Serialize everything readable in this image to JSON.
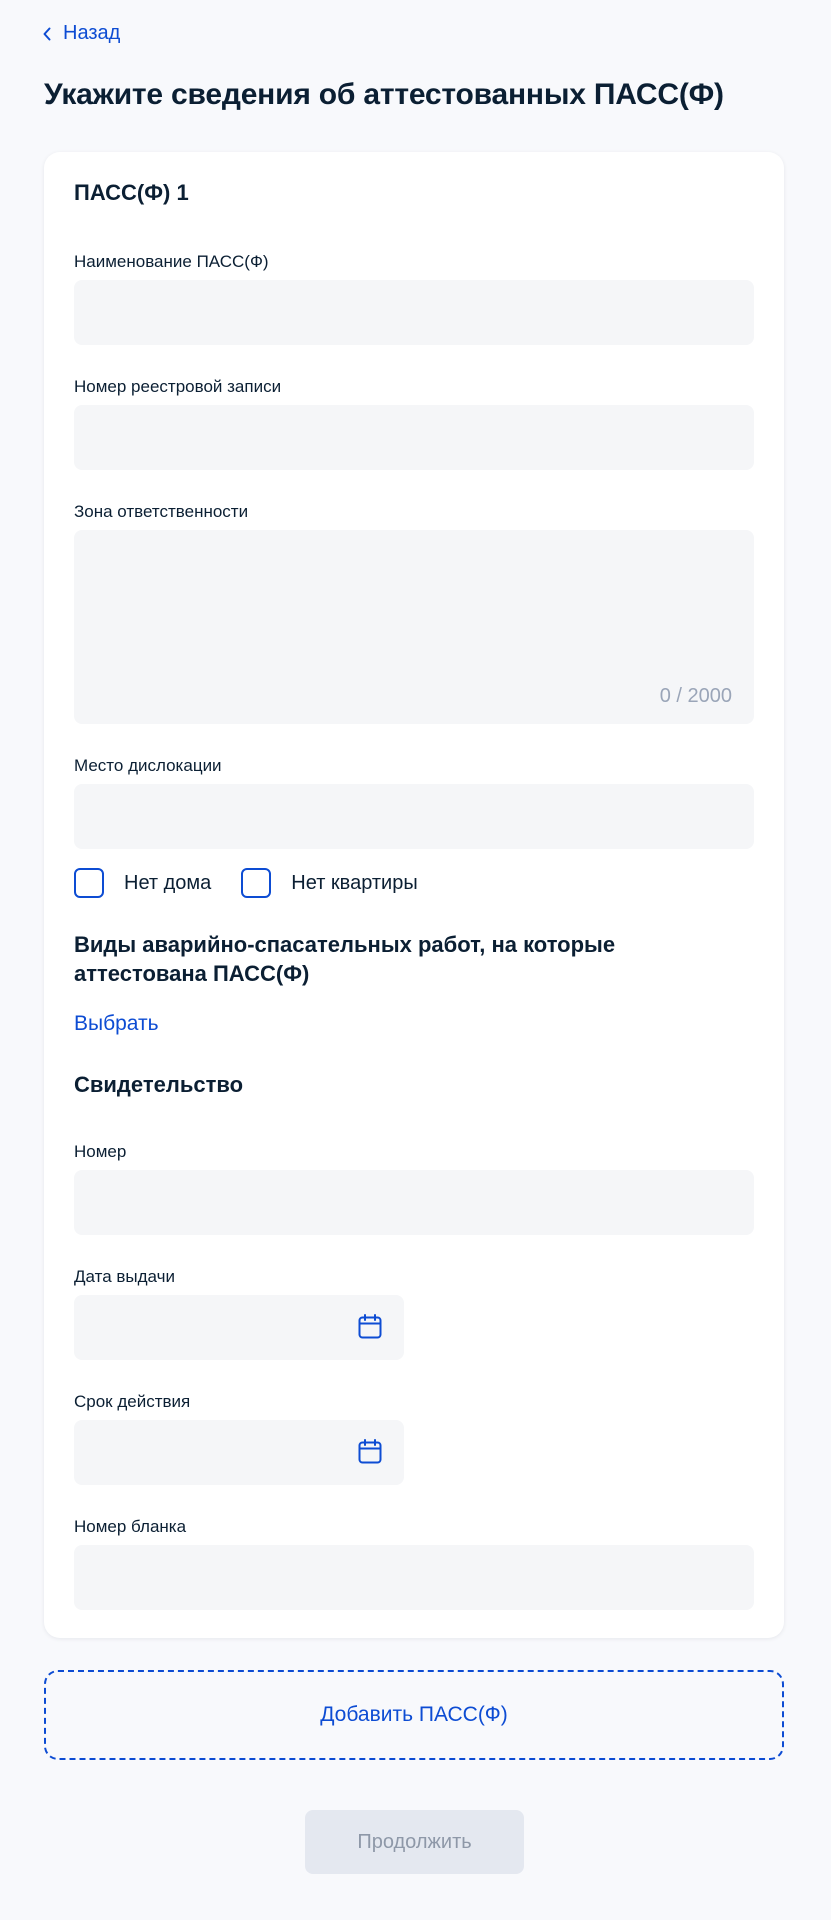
{
  "nav": {
    "back_label": "Назад"
  },
  "page": {
    "title": "Укажите сведения об аттестованных ПАСС(Ф)"
  },
  "card": {
    "title": "ПАСС(Ф) 1",
    "name_label": "Наименование ПАСС(Ф)",
    "registry_label": "Номер реестровой записи",
    "zone_label": "Зона ответственности",
    "zone_counter": "0 / 2000",
    "location_label": "Место дислокации",
    "checkboxes": [
      {
        "label": "Нет дома",
        "checked": false
      },
      {
        "label": "Нет квартиры",
        "checked": false
      }
    ],
    "works_title": "Виды аварийно-спасательных работ, на которые аттестована ПАСС(Ф)",
    "choose_label": "Выбрать",
    "certificate": {
      "title": "Свидетельство",
      "number_label": "Номер",
      "issue_date_label": "Дата выдачи",
      "valid_until_label": "Срок действия",
      "form_number_label": "Номер бланка"
    }
  },
  "actions": {
    "add_label": "Добавить ПАСС(Ф)",
    "continue_label": "Продолжить",
    "continue_disabled": true
  },
  "colors": {
    "accent": "#0d4cd3",
    "text": "#0b1f33",
    "field_bg": "#f5f6f8",
    "page_bg": "#f8f9fc",
    "disabled_bg": "#e4e8f0",
    "disabled_text": "#8e98a8"
  },
  "icons": {
    "back": "chevron-left-icon",
    "calendar": "calendar-icon"
  }
}
